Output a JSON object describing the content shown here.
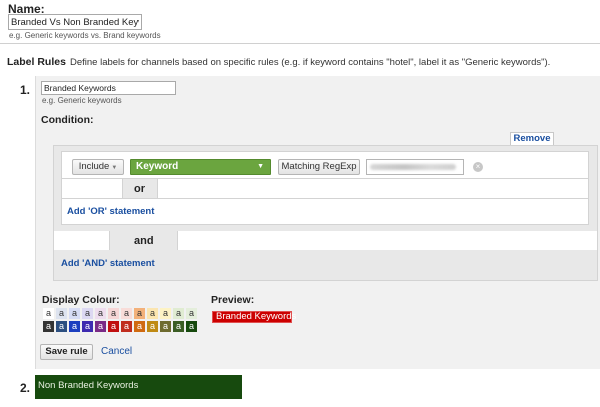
{
  "name_section": {
    "label": "Name:",
    "value": "Branded Vs Non Branded Keywords",
    "hint": "e.g. Generic keywords vs. Brand keywords"
  },
  "label_rules": {
    "title": "Label Rules",
    "description": "Define labels for channels based on specific rules (e.g. if keyword contains \"hotel\", label it as \"Generic keywords\")."
  },
  "rule1": {
    "number": "1.",
    "label_value": "Branded Keywords",
    "label_hint": "e.g. Generic keywords",
    "condition_label": "Condition:",
    "remove_label": "Remove",
    "include_label": "Include",
    "dimension_label": "Keyword",
    "match_type_label": "Matching RegExp",
    "or_text": "or",
    "add_or_label": "Add 'OR' statement",
    "and_text": "and",
    "add_and_label": "Add 'AND' statement",
    "display_colour_label": "Display Colour:",
    "preview_label": "Preview:",
    "preview_text": "Branded Keywords",
    "save_label": "Save rule",
    "cancel_label": "Cancel"
  },
  "colour_palette": {
    "light_row": [
      {
        "text": "a",
        "bg": "#ffffff",
        "fg": "#333333"
      },
      {
        "text": "a",
        "bg": "#dde3ef",
        "fg": "#333333"
      },
      {
        "text": "a",
        "bg": "#d6dcf5",
        "fg": "#333333"
      },
      {
        "text": "a",
        "bg": "#dcd8f2",
        "fg": "#333333"
      },
      {
        "text": "a",
        "bg": "#eeddee",
        "fg": "#333333"
      },
      {
        "text": "a",
        "bg": "#f6d6d6",
        "fg": "#333333"
      },
      {
        "text": "a",
        "bg": "#f8dcd8",
        "fg": "#333333"
      },
      {
        "text": "a",
        "bg": "#f3b17a",
        "fg": "#333333"
      },
      {
        "text": "a",
        "bg": "#fbe5b0",
        "fg": "#333333"
      },
      {
        "text": "a",
        "bg": "#fdf3c4",
        "fg": "#333333"
      },
      {
        "text": "a",
        "bg": "#e0ecd2",
        "fg": "#333333"
      },
      {
        "text": "a",
        "bg": "#e4eedb",
        "fg": "#333333"
      }
    ],
    "dark_row": [
      {
        "text": "a",
        "bg": "#333333",
        "fg": "#ffffff"
      },
      {
        "text": "a",
        "bg": "#2c4f80",
        "fg": "#ffffff"
      },
      {
        "text": "a",
        "bg": "#1d3fbf",
        "fg": "#ffffff"
      },
      {
        "text": "a",
        "bg": "#3d2ab0",
        "fg": "#ffffff"
      },
      {
        "text": "a",
        "bg": "#7a2a86",
        "fg": "#ffffff"
      },
      {
        "text": "a",
        "bg": "#c01010",
        "fg": "#ffffff"
      },
      {
        "text": "a",
        "bg": "#c02d1e",
        "fg": "#ffffff"
      },
      {
        "text": "a",
        "bg": "#d06a10",
        "fg": "#ffffff"
      },
      {
        "text": "a",
        "bg": "#bf8a14",
        "fg": "#ffffff"
      },
      {
        "text": "a",
        "bg": "#6e6b2f",
        "fg": "#ffffff"
      },
      {
        "text": "a",
        "bg": "#3b5d24",
        "fg": "#ffffff"
      },
      {
        "text": "a",
        "bg": "#174a0e",
        "fg": "#ffffff"
      }
    ]
  },
  "rule2": {
    "number": "2.",
    "label_value": "Non Branded Keywords"
  },
  "icons": {
    "clear": "clear-icon",
    "dropdown": "chevron-down-icon"
  },
  "colors": {
    "link": "#1a4fa0",
    "dimension_chip": "#6ba53f",
    "preview_chip": "#cc0000",
    "rule2_chip": "#174a0e"
  }
}
